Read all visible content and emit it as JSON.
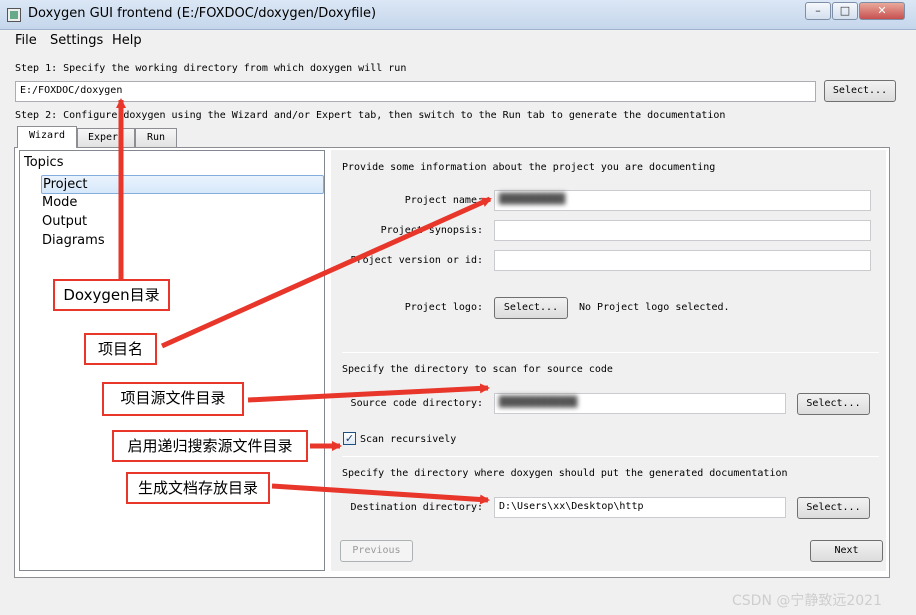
{
  "window": {
    "title": "Doxygen GUI frontend (E:/FOXDOC/doxygen/Doxyfile)",
    "min_label": "–",
    "max_label": "□",
    "close_label": "✕"
  },
  "menu": [
    "File",
    "Settings",
    "Help"
  ],
  "step1": {
    "text": "Step 1: Specify the working directory from which doxygen will run",
    "dir_value": "E:/FOXDOC/doxygen",
    "select_label": "Select..."
  },
  "step2": {
    "text": "Step 2: Configure doxygen using the Wizard and/or Expert tab, then switch to the Run tab to generate the documentation"
  },
  "tabs": [
    "Wizard",
    "Expert",
    "Run"
  ],
  "topics": {
    "title": "Topics",
    "items": [
      "Project",
      "Mode",
      "Output",
      "Diagrams"
    ]
  },
  "project": {
    "intro": "Provide some information about the project you are documenting",
    "name_label": "Project name:",
    "name_value": "███████████",
    "synopsis_label": "Project synopsis:",
    "version_label": "Project version or id:",
    "logo_label": "Project logo:",
    "logo_button": "Select...",
    "logo_status": "No Project logo selected."
  },
  "source": {
    "intro": "Specify the directory to scan for source code",
    "label": "Source code directory:",
    "value": "█████████████",
    "select_label": "Select...",
    "scan_label": "Scan recursively",
    "scan_checked": true,
    "check_mark": "✓"
  },
  "destination": {
    "intro": "Specify the directory where doxygen should put the generated documentation",
    "label": "Destination directory:",
    "value": "D:\\Users\\xx\\Desktop\\http",
    "select_label": "Select..."
  },
  "nav": {
    "previous": "Previous",
    "next": "Next"
  },
  "annotations": {
    "doxygen_dir": "Doxygen目录",
    "project_name": "项目名",
    "source_dir": "项目源文件目录",
    "recursive": "启用递归搜索源文件目录",
    "output_dir": "生成文档存放目录",
    "color": "#e8362b"
  },
  "watermark": "CSDN @宁静致远2021"
}
